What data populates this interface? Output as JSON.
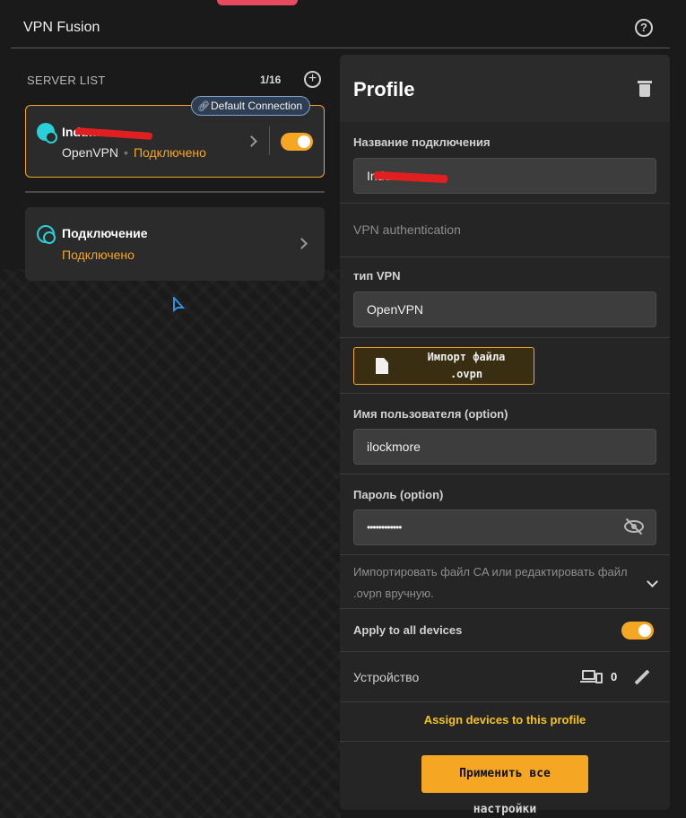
{
  "header": {
    "title": "VPN Fusion"
  },
  "server_list": {
    "label": "SERVER LIST",
    "count": "1/16",
    "default_badge": "Default Connection",
    "cards": [
      {
        "title": "Indu…a",
        "protocol": "OpenVPN",
        "status": "Подключено",
        "enabled": true
      },
      {
        "title": "Подключение",
        "status": "Подключено"
      }
    ]
  },
  "profile": {
    "title": "Profile",
    "connection_name_label": "Название подключения",
    "connection_name_value": "Indu…a",
    "vpn_auth_label": "VPN authentication",
    "vpn_type_label": "тип VPN",
    "vpn_type_value": "OpenVPN",
    "import_button_line1": "Импорт файла",
    "import_button_line2": ".ovpn",
    "username_label": "Имя пользователя (option)",
    "username_value": "ilockmore",
    "password_label": "Пароль (option)",
    "password_value": "••••••••••••",
    "ca_text": "Импортировать файл CA или редактировать файл .ovpn вручную.",
    "apply_all_label": "Apply to all devices",
    "apply_all_enabled": true,
    "device_label": "Устройство",
    "device_count": "0",
    "assign_link": "Assign devices to this profile",
    "apply_button_line1": "Применить все",
    "apply_button_line2": "настройки"
  },
  "colors": {
    "accent": "#f5a623",
    "link": "#f5c31a",
    "icon_teal": "#2ad0d8",
    "redaction": "#e02020"
  }
}
